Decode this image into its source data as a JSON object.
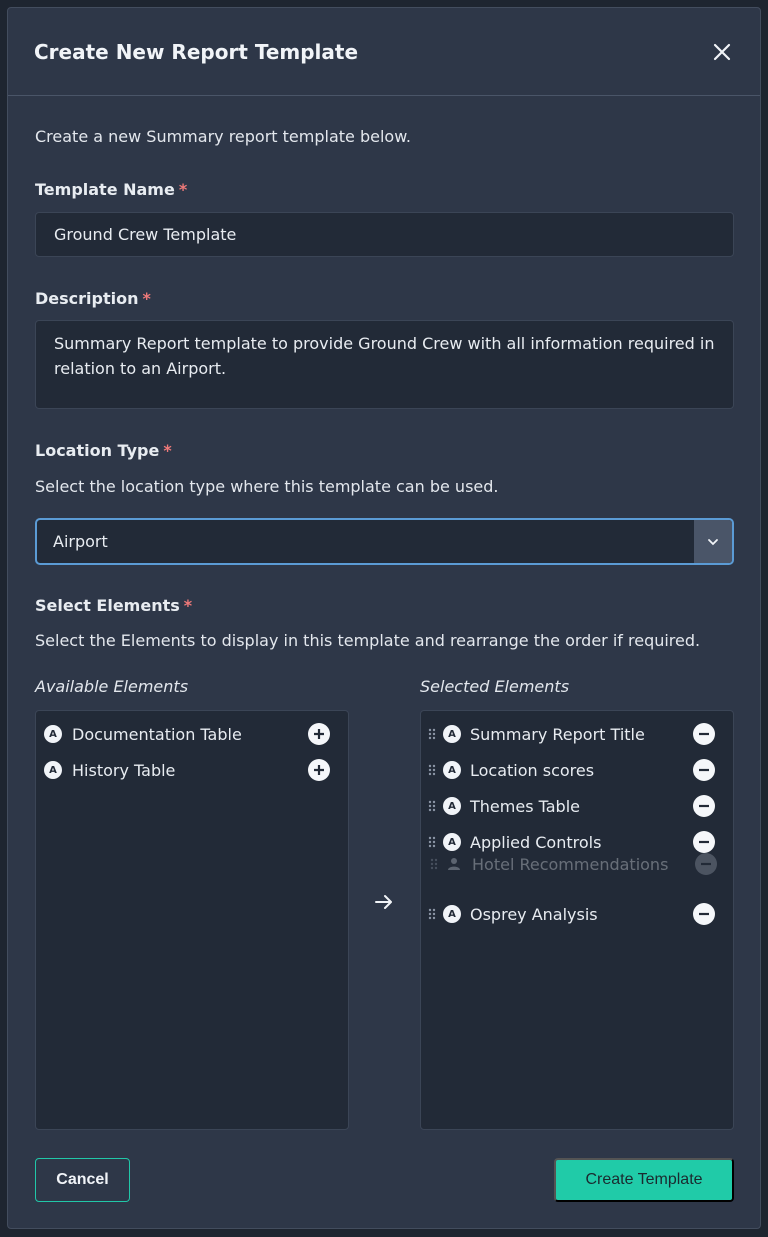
{
  "dialog": {
    "title": "Create New Report Template",
    "intro": "Create a new Summary report template below."
  },
  "template_name": {
    "label": "Template Name",
    "required_mark": "*",
    "value": "Ground Crew Template"
  },
  "description": {
    "label": "Description",
    "required_mark": "*",
    "value": "Summary Report template to provide Ground Crew with all information required in relation to an Airport."
  },
  "location_type": {
    "label": "Location Type",
    "required_mark": "*",
    "help": "Select the location type where this template can be used.",
    "selected": "Airport"
  },
  "elements": {
    "label": "Select Elements",
    "required_mark": "*",
    "help": "Select the Elements to display in this template and rearrange the order if required.",
    "available_label": "Available Elements",
    "selected_label": "Selected Elements",
    "available": [
      {
        "badge": "A",
        "label": "Documentation Table"
      },
      {
        "badge": "A",
        "label": "History Table"
      }
    ],
    "selected": [
      {
        "badge": "A",
        "label": "Summary Report Title"
      },
      {
        "badge": "A",
        "label": "Location scores"
      },
      {
        "badge": "A",
        "label": "Themes Table"
      },
      {
        "badge": "A",
        "label": "Applied Controls"
      },
      {
        "badge": "A",
        "label": "Osprey Analysis"
      }
    ],
    "dragging": {
      "label": "Hotel Recommendations"
    }
  },
  "actions": {
    "cancel": "Cancel",
    "create": "Create Template"
  }
}
